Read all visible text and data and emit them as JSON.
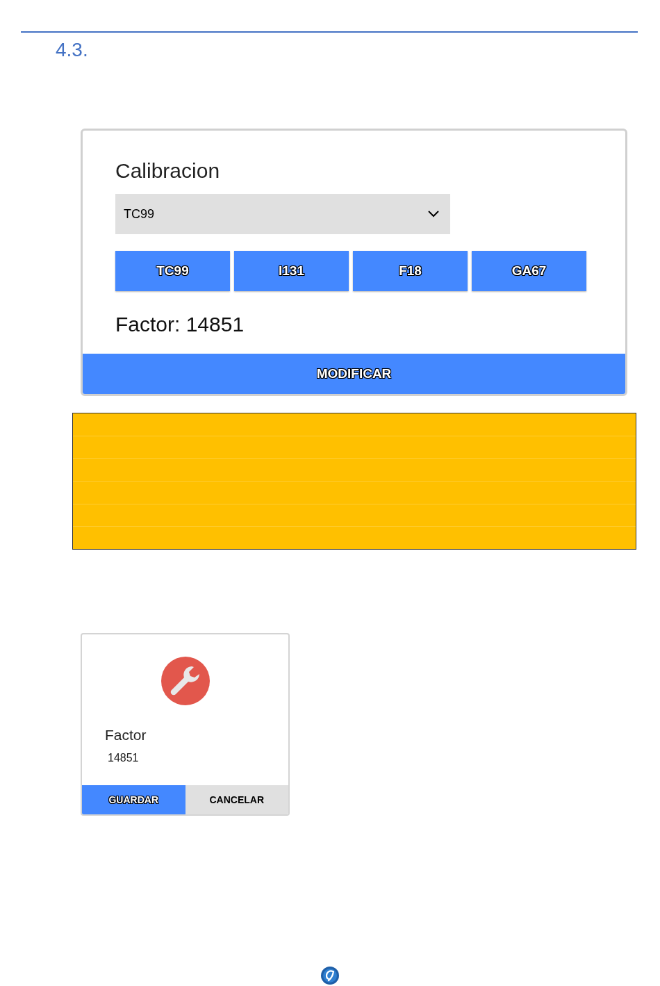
{
  "heading": {
    "number": "4.3."
  },
  "calibration_card": {
    "title": "Calibracion",
    "select": {
      "value": "TC99"
    },
    "isotope_buttons": [
      "TC99",
      "I131",
      "F18",
      "GA67"
    ],
    "factor": "Factor: 14851",
    "action_button": "MODIFICAR"
  },
  "note_box": {
    "kind": "empty"
  },
  "factor_dialog": {
    "title": "Factor",
    "value": "14851",
    "buttons": [
      {
        "label": "GUARDAR",
        "kind": "primary"
      },
      {
        "label": "CANCELAR",
        "kind": "secondary"
      }
    ]
  }
}
